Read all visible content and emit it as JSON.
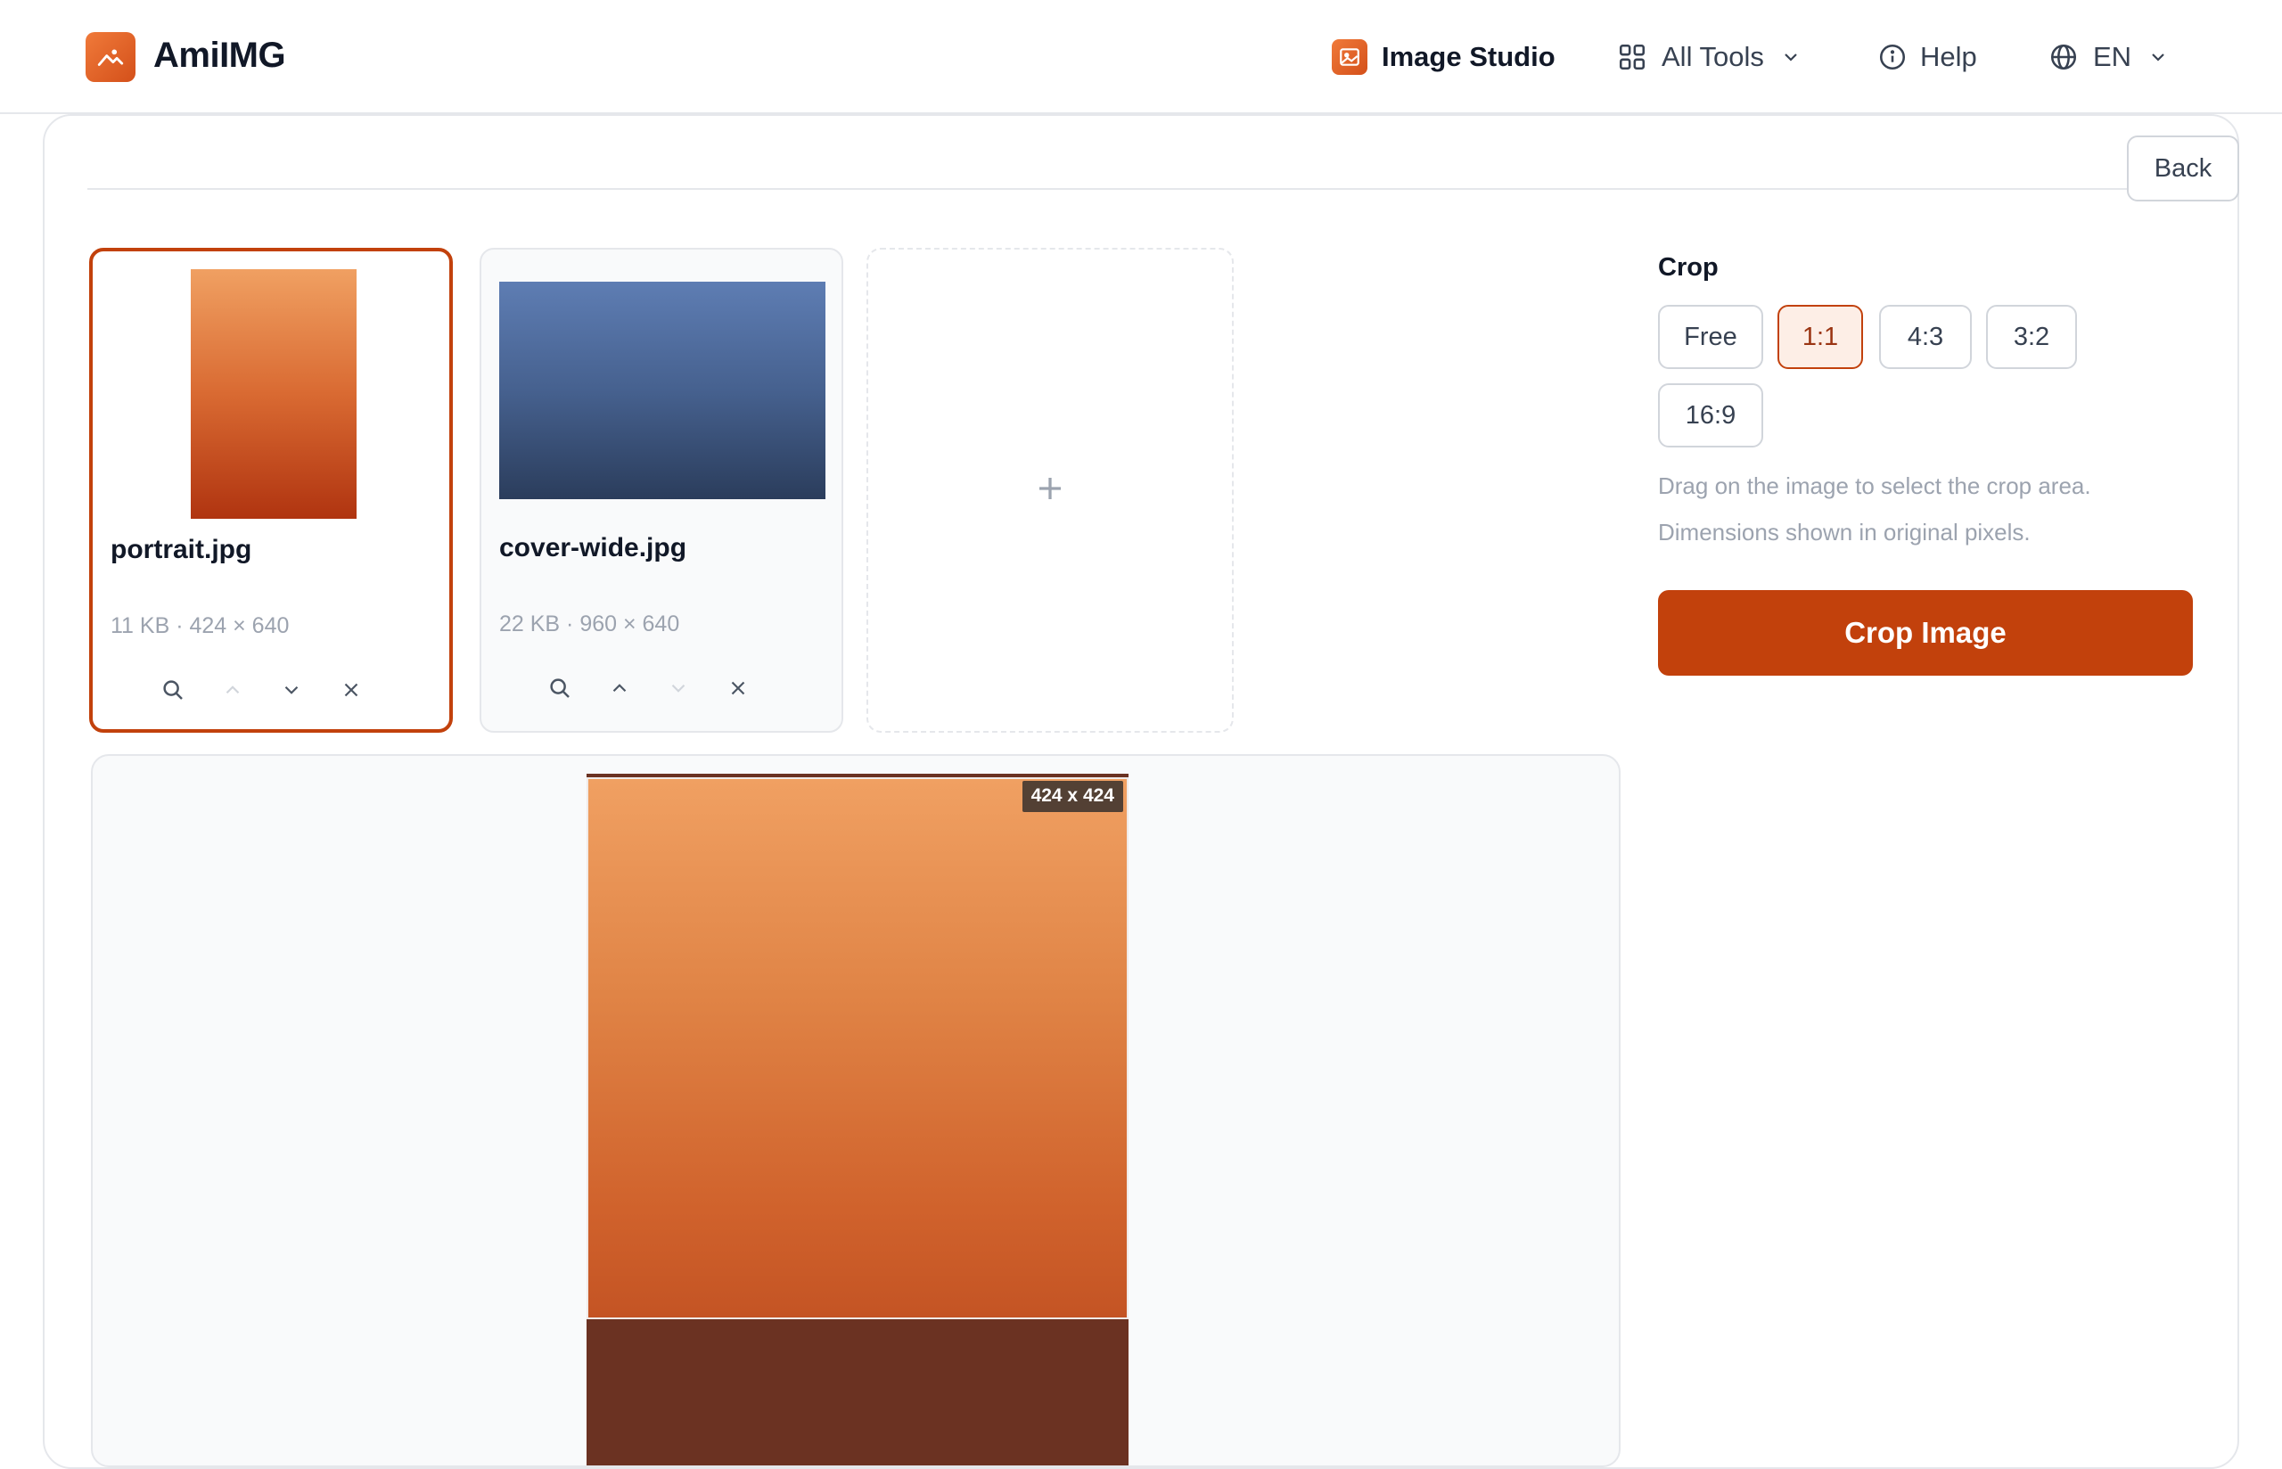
{
  "app": {
    "brand": "AmiIMG"
  },
  "nav": {
    "studio": "Image Studio",
    "tools": "All Tools",
    "help": "Help",
    "language": "EN"
  },
  "toolbar": {
    "back": "Back"
  },
  "files": [
    {
      "name": "portrait.jpg",
      "meta": "11 KB · 424 × 640",
      "selected": true
    },
    {
      "name": "cover-wide.jpg",
      "meta": "22 KB · 960 × 640",
      "selected": false
    }
  ],
  "crop": {
    "title": "Crop",
    "ratios": [
      "Free",
      "1:1",
      "4:3",
      "3:2",
      "16:9"
    ],
    "active_ratio": "1:1",
    "help_line1": "Drag on the image to select the crop area.",
    "help_line2": "Dimensions shown in original pixels.",
    "button": "Crop Image",
    "selection_label": "424 x 424"
  },
  "colors": {
    "accent": "#c2410c",
    "accent_light": "#fdeee6"
  },
  "icons": [
    "logo-icon",
    "image-icon",
    "grid-icon",
    "chevron-down-icon",
    "info-icon",
    "globe-icon",
    "search-icon",
    "chevron-up-icon",
    "close-icon",
    "plus-icon"
  ]
}
